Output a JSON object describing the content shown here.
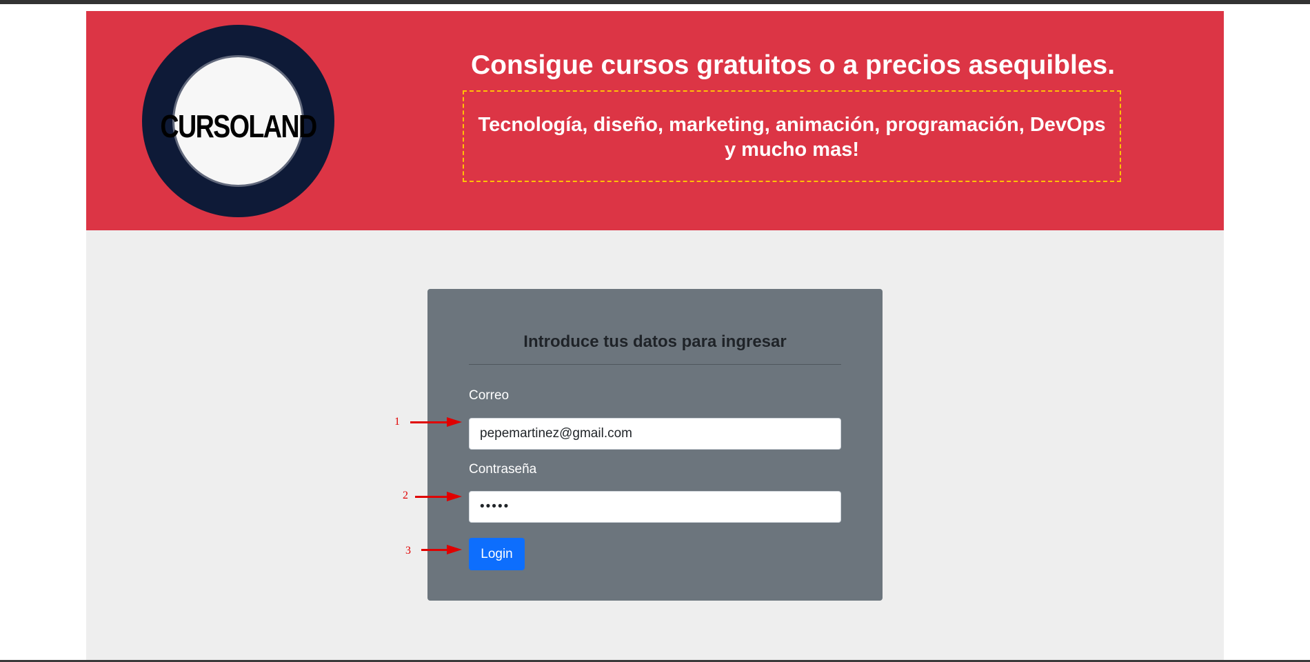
{
  "colors": {
    "hero_background": "#dc3545",
    "page_background": "#eeeeee",
    "card_background": "#6c757d",
    "logo_ring": "#0e1a37",
    "dashed_border": "#ffc107",
    "button": "#0d6efd",
    "annotation": "#e00000"
  },
  "hero": {
    "logo_text": "CURSOLAND",
    "title": "Consigue cursos gratuitos o a precios asequibles.",
    "subtitle_line1": "Tecnología, diseño, marketing, animación, programación, DevOps",
    "subtitle_line2": "y mucho mas!"
  },
  "login": {
    "title": "Introduce tus datos para ingresar",
    "email_label": "Correo",
    "email_value": "pepemartinez@gmail.com",
    "password_label": "Contraseña",
    "password_value": "•••••",
    "button_label": "Login"
  },
  "annotations": [
    "1",
    "2",
    "3"
  ]
}
